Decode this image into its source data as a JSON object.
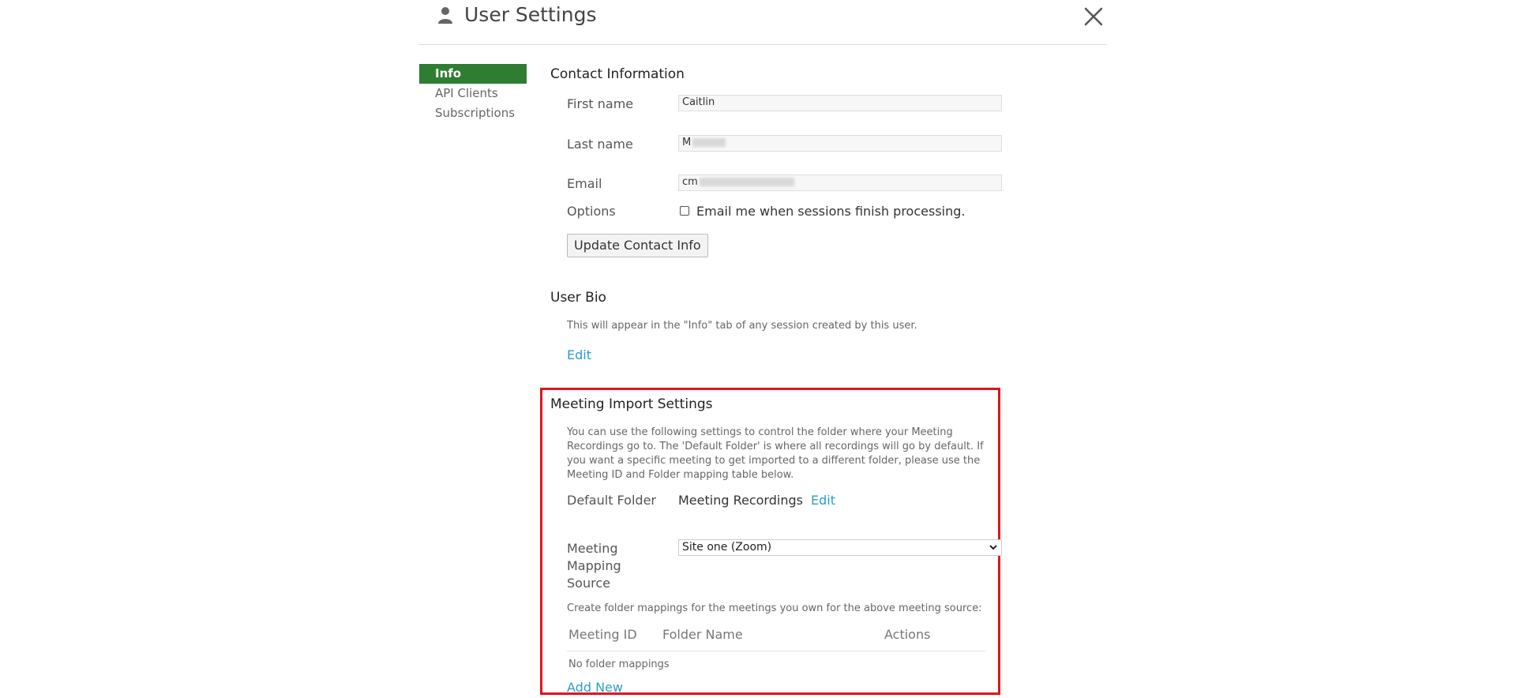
{
  "header": {
    "title": "User Settings",
    "user_icon": "user-icon",
    "close_icon": "close-icon"
  },
  "sidebar": {
    "items": [
      {
        "label": "Info",
        "active": true
      },
      {
        "label": "API Clients",
        "active": false
      },
      {
        "label": "Subscriptions",
        "active": false
      }
    ]
  },
  "contact": {
    "heading": "Contact Information",
    "first_name_label": "First name",
    "first_name_value": "Caitlin",
    "last_name_label": "Last name",
    "last_name_value": "M",
    "email_label": "Email",
    "email_value": "cm",
    "options_label": "Options",
    "email_option_text": "Email me when sessions finish processing.",
    "email_option_checked": false,
    "update_button": "Update Contact Info"
  },
  "bio": {
    "heading": "User Bio",
    "description": "This will appear in the \"Info\" tab of any session created by this user.",
    "edit_link": "Edit"
  },
  "meeting_import": {
    "heading": "Meeting Import Settings",
    "description": "You can use the following settings to control the folder where your Meeting Recordings go to. The 'Default Folder' is where all recordings will go by default. If you want a specific meeting to get imported to a different folder, please use the Meeting ID and Folder mapping table below.",
    "default_folder_label": "Default Folder",
    "default_folder_value": "Meeting Recordings",
    "default_folder_edit": "Edit",
    "mapping_source_label": "Meeting Mapping Source",
    "mapping_source_value": "Site one (Zoom)",
    "mapping_instructions": "Create folder mappings for the meetings you own for the above meeting source:",
    "table_headers": [
      "Meeting ID",
      "Folder Name",
      "Actions"
    ],
    "empty_text": "No folder mappings",
    "add_new": "Add New"
  },
  "colors": {
    "active_tab": "#2e7d32",
    "link": "#2a9fc9",
    "highlight": "#e0141e"
  }
}
